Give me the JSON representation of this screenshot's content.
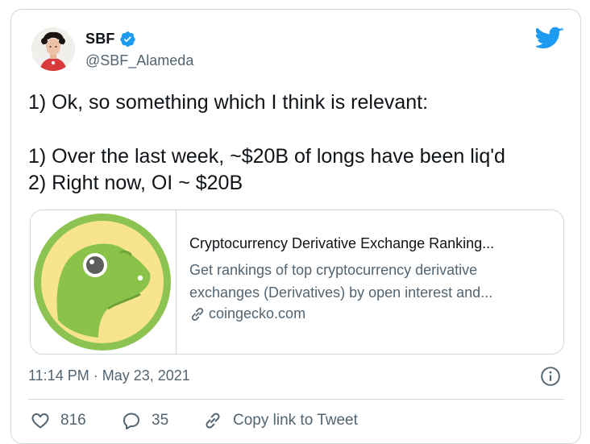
{
  "user": {
    "name": "SBF",
    "handle": "@SBF_Alameda"
  },
  "tweet": {
    "lines": [
      "1) Ok, so something which I think is relevant:",
      "1) Over the last week, ~$20B of longs have been liq'd",
      "2) Right now, OI ~ $20B"
    ]
  },
  "link_card": {
    "title": "Cryptocurrency Derivative Exchange Ranking...",
    "description_lines": [
      "Get rankings of top cryptocurrency derivative",
      "exchanges (Derivatives) by open interest and..."
    ],
    "domain": "coingecko.com"
  },
  "meta": {
    "timestamp": "11:14 PM · May 23, 2021"
  },
  "actions": {
    "likes": "816",
    "replies": "35",
    "copy_link": "Copy link to Tweet"
  },
  "colors": {
    "twitter_blue": "#1d9bf0",
    "secondary_text": "#536471",
    "border": "#cfd9de"
  },
  "icons": [
    "verified-badge-icon",
    "twitter-bird-icon",
    "link-icon",
    "info-icon",
    "heart-icon",
    "reply-icon",
    "copy-link-icon"
  ]
}
